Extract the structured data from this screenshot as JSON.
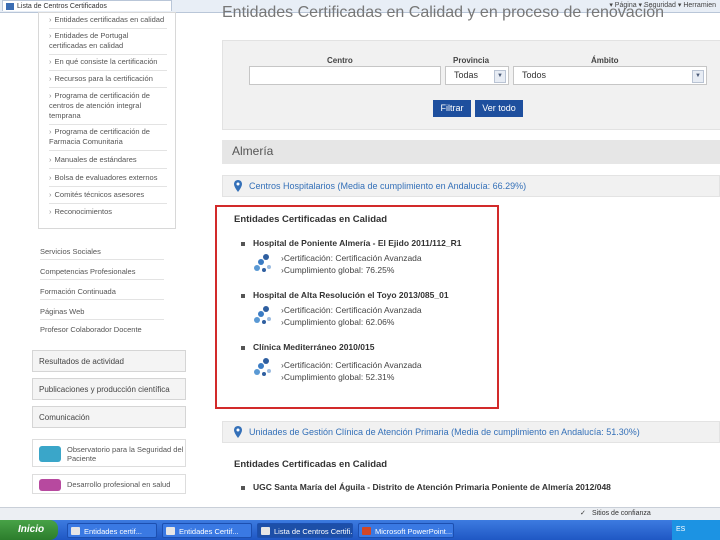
{
  "browser": {
    "tab_title": "Lista de Centros Certificados",
    "toolbar_right": "▾ Página ▾ Seguridad ▾ Herramien"
  },
  "sidebar": {
    "subitems": [
      {
        "label": "Entidades certificadas en calidad",
        "top": 0
      },
      {
        "label": "Entidades de Portugal certificadas en calidad"
      },
      {
        "label": "En qué consiste la certificación"
      },
      {
        "label": "Recursos para la certificación"
      },
      {
        "label": "Programa de certificación de centros de atención integral temprana"
      },
      {
        "label": "Programa de certificación de Farmacia Comunitaria"
      },
      {
        "label": "Manuales de estándares"
      },
      {
        "label": "Bolsa de evaluadores externos"
      },
      {
        "label": "Comités técnicos asesores"
      },
      {
        "label": "Reconocimientos"
      }
    ],
    "items": [
      "Servicios Sociales",
      "Competencias Profesionales",
      "Formación Continuada",
      "Páginas Web",
      "Profesor Colaborador Docente"
    ],
    "boxes": [
      "Resultados de actividad",
      "Publicaciones y producción científica",
      "Comunicación"
    ],
    "promos": [
      "Observatorio para la Seguridad del Paciente",
      "Desarrollo profesional en salud"
    ]
  },
  "main": {
    "heading": "Entidades Certificadas en Calidad y en proceso de renovación",
    "filters": {
      "centro_label": "Centro",
      "centro_value": "",
      "provincia_label": "Provincia",
      "provincia_value": "Todas",
      "ambito_label": "Ámbito",
      "ambito_value": "Todos",
      "filter_button": "Filtrar",
      "all_button": "Ver todo"
    },
    "province": "Almería",
    "sections": [
      {
        "header": "Centros Hospitalarios (Media de cumplimiento en Andalucía: 66.29%)",
        "title": "Entidades Certificadas en Calidad",
        "entries": [
          {
            "name": "Hospital de Poniente Almería - El Ejido 2011/112_R1",
            "cert": "›Certificación: Certificación Avanzada",
            "score": "›Cumplimiento global: 76.25%"
          },
          {
            "name": "Hospital de Alta Resolución el Toyo 2013/085_01",
            "cert": "›Certificación: Certificación Avanzada",
            "score": "›Cumplimiento global: 62.06%"
          },
          {
            "name": "Clínica Mediterráneo 2010/015",
            "cert": "›Certificación: Certificación Avanzada",
            "score": "›Cumplimiento global: 52.31%"
          }
        ]
      },
      {
        "header": "Unidades de Gestión Clínica de Atención Primaria (Media de cumplimiento en Andalucía: 51.30%)",
        "title": "Entidades Certificadas en Calidad",
        "entries": [
          {
            "name": "UGC Santa María del Águila - Distrito de Atención Primaria Poniente de Almería 2012/048"
          }
        ]
      }
    ]
  },
  "statusbar": {
    "right": "Sitios de confianza"
  },
  "taskbar": {
    "start": "Inicio",
    "buttons": [
      "Entidades certif...",
      "Entidades Certif...",
      "Lista de Centros Certifi...",
      "Microsoft PowerPoint..."
    ],
    "tray": "ES"
  },
  "colors": {
    "accent_blue": "#1e4f9e",
    "link_blue": "#3470b8",
    "highlight_red": "#d22a2a"
  }
}
